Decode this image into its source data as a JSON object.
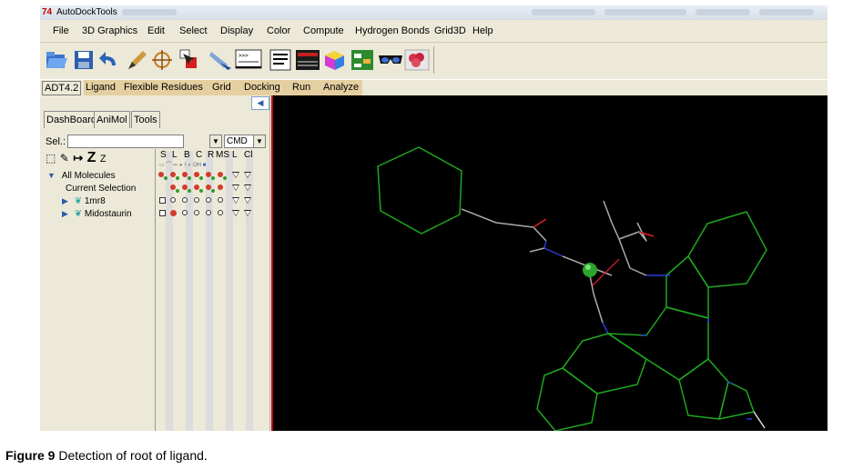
{
  "window": {
    "title": "AutoDockTools"
  },
  "menu": [
    "File",
    "3D Graphics",
    "Edit",
    "Select",
    "Display",
    "Color",
    "Compute",
    "Hydrogen Bonds",
    "Grid3D",
    "Help"
  ],
  "toolbar_icons": [
    "open-folder-icon",
    "save-icon",
    "undo-icon",
    "pencil-icon",
    "crosshair-icon",
    "pick-icon",
    "hand-pointer-icon",
    "python-shell-icon",
    "text-lines-icon",
    "sequence-icon",
    "color-cube-icon",
    "grid-icon",
    "stereo-glasses-icon",
    "raspberry-icon"
  ],
  "adt_tabs": {
    "version": "ADT4.2",
    "items": [
      "Ligand",
      "Flexible Residues",
      "Grid",
      "Docking",
      "Run",
      "Analyze"
    ]
  },
  "left_tabs": [
    "DashBoard",
    "AniMol",
    "Tools"
  ],
  "selector": {
    "label": "Sel.:",
    "value": "",
    "cmd": "CMD"
  },
  "tree": {
    "root": "All Molecules",
    "current": "Current Selection",
    "molecules": [
      "1mr8",
      "Midostaurin"
    ]
  },
  "columns": [
    "S",
    "L",
    "B",
    "C",
    "R",
    "MS",
    "L",
    "Cl"
  ],
  "caption": {
    "label": "Figure 9",
    "text": "Detection of root of ligand."
  },
  "colors": {
    "bond_green": "#1fa81f",
    "root_atom": "#2aa52a",
    "nitrogen": "#2b3cd6",
    "oxygen": "#e02020",
    "viewer_bg": "#000000",
    "tab_highlight": "#e4cfa0"
  }
}
